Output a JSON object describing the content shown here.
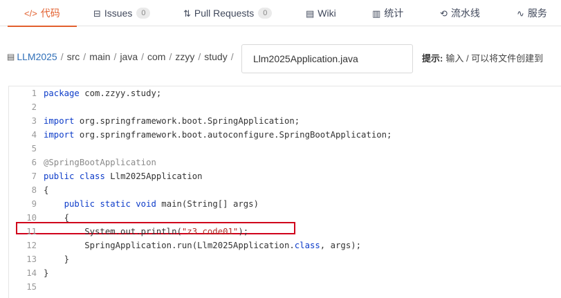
{
  "tabs": [
    {
      "icon": "code-icon",
      "glyph": "</>",
      "label": "代码",
      "active": true
    },
    {
      "icon": "issues-icon",
      "glyph": "⊟",
      "label": "Issues",
      "count": "0"
    },
    {
      "icon": "pull-request-icon",
      "glyph": "⇅",
      "label": "Pull Requests",
      "count": "0"
    },
    {
      "icon": "wiki-icon",
      "glyph": "▤",
      "label": "Wiki"
    },
    {
      "icon": "stats-icon",
      "glyph": "▥",
      "label": "统计"
    },
    {
      "icon": "pipeline-icon",
      "glyph": "⟲",
      "label": "流水线"
    },
    {
      "icon": "service-icon",
      "glyph": "∿",
      "label": "服务"
    }
  ],
  "breadcrumb": {
    "repo_icon": "repo-icon",
    "repo": "LLM2025",
    "segments": [
      "src",
      "main",
      "java",
      "com",
      "zzyy",
      "study"
    ],
    "separator": "/"
  },
  "filename_input": {
    "value": "Llm2025Application.java"
  },
  "hint": {
    "label": "提示:",
    "text": "输入 / 可以将文件创建到"
  },
  "code_lines": [
    {
      "n": "1",
      "parts": [
        {
          "t": "package",
          "c": "kw"
        },
        {
          "t": " com.zzyy.study;"
        }
      ]
    },
    {
      "n": "2",
      "parts": []
    },
    {
      "n": "3",
      "parts": [
        {
          "t": "import",
          "c": "kw"
        },
        {
          "t": " org.springframework.boot.SpringApplication;"
        }
      ]
    },
    {
      "n": "4",
      "parts": [
        {
          "t": "import",
          "c": "kw"
        },
        {
          "t": " org.springframework.boot.autoconfigure.SpringBootApplication;"
        }
      ]
    },
    {
      "n": "5",
      "parts": []
    },
    {
      "n": "6",
      "parts": [
        {
          "t": "@SpringBootApplication",
          "c": "anno"
        }
      ]
    },
    {
      "n": "7",
      "parts": [
        {
          "t": "public",
          "c": "kw"
        },
        {
          "t": " "
        },
        {
          "t": "class",
          "c": "kw"
        },
        {
          "t": " Llm2025Application"
        }
      ]
    },
    {
      "n": "8",
      "parts": [
        {
          "t": "{"
        }
      ]
    },
    {
      "n": "9",
      "parts": [
        {
          "t": "    "
        },
        {
          "t": "public",
          "c": "kw"
        },
        {
          "t": " "
        },
        {
          "t": "static",
          "c": "kw"
        },
        {
          "t": " "
        },
        {
          "t": "void",
          "c": "kw"
        },
        {
          "t": " main(String[] args)"
        }
      ]
    },
    {
      "n": "10",
      "parts": [
        {
          "t": "    {"
        }
      ]
    },
    {
      "n": "11",
      "parts": [
        {
          "t": "        System.out.println("
        },
        {
          "t": "\"z3 code01\"",
          "c": "str"
        },
        {
          "t": ");"
        }
      ]
    },
    {
      "n": "12",
      "parts": [
        {
          "t": "        SpringApplication.run(Llm2025Application."
        },
        {
          "t": "class",
          "c": "kw"
        },
        {
          "t": ", args);"
        }
      ]
    },
    {
      "n": "13",
      "parts": [
        {
          "t": "    }"
        }
      ]
    },
    {
      "n": "14",
      "parts": [
        {
          "t": "}"
        }
      ]
    },
    {
      "n": "15",
      "parts": []
    }
  ],
  "colors": {
    "accent": "#e25f2d",
    "link": "#2f6fb8",
    "keyword": "#0d3cc9",
    "highlight": "#d0021b"
  }
}
